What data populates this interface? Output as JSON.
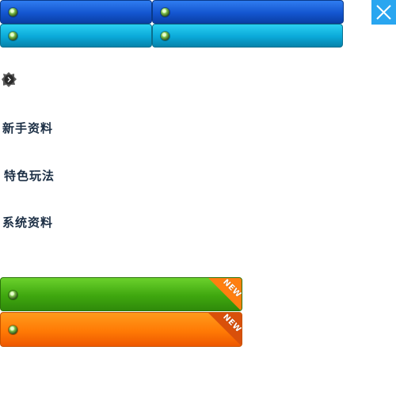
{
  "menu": {
    "section_1": "新手资料",
    "section_2": "特色玩法",
    "section_3": "系统资料"
  },
  "badges": {
    "new_1": "NEW",
    "new_2": "NEW"
  },
  "colors": {
    "blue_button": "#1456d0",
    "cyan_button": "#0aa8d8",
    "green_button": "#3fa70f",
    "orange_button": "#ff7a05",
    "close_button": "#29a6f0"
  },
  "icons": {
    "close": "close-icon",
    "expand": "chevron-right-icon",
    "gem": "gem-icon"
  }
}
